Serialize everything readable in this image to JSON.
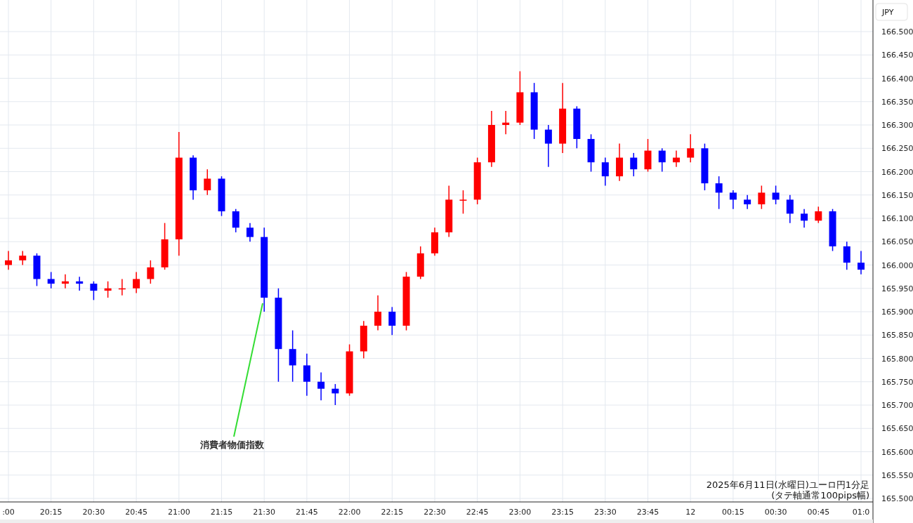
{
  "chart": {
    "currency_label": "JPY",
    "caption_lines": [
      "2025年6月11日(水曜日)ユーロ円1分足",
      "(タテ軸通常100pips幅)"
    ],
    "chart_data": {
      "type": "candlestick",
      "grid": true,
      "ylim": [
        165.5,
        166.5
      ],
      "categories": [
        ":00",
        null,
        null,
        "20:15",
        null,
        null,
        "20:30",
        null,
        null,
        "20:45",
        null,
        null,
        "21:00",
        null,
        null,
        "21:15",
        null,
        null,
        "21:30",
        null,
        null,
        "21:45",
        null,
        null,
        "22:00",
        null,
        null,
        "22:15",
        null,
        null,
        "22:30",
        null,
        null,
        "22:45",
        null,
        null,
        "23:00",
        null,
        null,
        "23:15",
        null,
        null,
        "23:30",
        null,
        null,
        "23:45",
        null,
        null,
        "12",
        null,
        null,
        "00:15",
        null,
        null,
        "00:30",
        null,
        null,
        "00:45",
        null,
        null,
        "01:0"
      ],
      "ohlc": [
        [
          166.0,
          166.03,
          165.99,
          166.01
        ],
        [
          166.01,
          166.03,
          166.0,
          166.02
        ],
        [
          166.02,
          166.025,
          165.955,
          165.97
        ],
        [
          165.97,
          165.985,
          165.95,
          165.96
        ],
        [
          165.96,
          165.98,
          165.95,
          165.965
        ],
        [
          165.965,
          165.975,
          165.945,
          165.96
        ],
        [
          165.96,
          165.965,
          165.925,
          165.945
        ],
        [
          165.945,
          165.965,
          165.93,
          165.95
        ],
        [
          165.95,
          165.97,
          165.935,
          165.95
        ],
        [
          165.95,
          165.985,
          165.94,
          165.97
        ],
        [
          165.97,
          166.01,
          165.96,
          165.995
        ],
        [
          165.995,
          166.09,
          165.99,
          166.055
        ],
        [
          166.055,
          166.285,
          166.02,
          166.23
        ],
        [
          166.23,
          166.235,
          166.14,
          166.16
        ],
        [
          166.16,
          166.205,
          166.15,
          166.185
        ],
        [
          166.185,
          166.19,
          166.105,
          166.115
        ],
        [
          166.115,
          166.12,
          166.07,
          166.08
        ],
        [
          166.08,
          166.09,
          166.05,
          166.06
        ],
        [
          166.06,
          166.08,
          165.9,
          165.93
        ],
        [
          165.93,
          165.95,
          165.75,
          165.82
        ],
        [
          165.82,
          165.86,
          165.75,
          165.785
        ],
        [
          165.785,
          165.81,
          165.72,
          165.75
        ],
        [
          165.75,
          165.77,
          165.71,
          165.735
        ],
        [
          165.735,
          165.745,
          165.7,
          165.725
        ],
        [
          165.725,
          165.83,
          165.72,
          165.815
        ],
        [
          165.815,
          165.88,
          165.8,
          165.87
        ],
        [
          165.87,
          165.935,
          165.86,
          165.9
        ],
        [
          165.9,
          165.91,
          165.85,
          165.87
        ],
        [
          165.87,
          165.985,
          165.86,
          165.975
        ],
        [
          165.975,
          166.04,
          165.97,
          166.025
        ],
        [
          166.025,
          166.08,
          166.02,
          166.07
        ],
        [
          166.07,
          166.17,
          166.06,
          166.14
        ],
        [
          166.14,
          166.16,
          166.11,
          166.14
        ],
        [
          166.14,
          166.23,
          166.13,
          166.22
        ],
        [
          166.22,
          166.33,
          166.21,
          166.3
        ],
        [
          166.3,
          166.33,
          166.28,
          166.305
        ],
        [
          166.305,
          166.415,
          166.3,
          166.37
        ],
        [
          166.37,
          166.39,
          166.27,
          166.29
        ],
        [
          166.29,
          166.3,
          166.21,
          166.26
        ],
        [
          166.26,
          166.39,
          166.24,
          166.335
        ],
        [
          166.335,
          166.34,
          166.25,
          166.27
        ],
        [
          166.27,
          166.28,
          166.2,
          166.22
        ],
        [
          166.22,
          166.23,
          166.17,
          166.19
        ],
        [
          166.19,
          166.26,
          166.18,
          166.23
        ],
        [
          166.23,
          166.24,
          166.19,
          166.205
        ],
        [
          166.205,
          166.27,
          166.2,
          166.245
        ],
        [
          166.245,
          166.25,
          166.2,
          166.22
        ],
        [
          166.22,
          166.245,
          166.21,
          166.23
        ],
        [
          166.23,
          166.28,
          166.22,
          166.25
        ],
        [
          166.25,
          166.26,
          166.16,
          166.175
        ],
        [
          166.175,
          166.19,
          166.12,
          166.155
        ],
        [
          166.155,
          166.16,
          166.12,
          166.14
        ],
        [
          166.14,
          166.15,
          166.12,
          166.13
        ],
        [
          166.13,
          166.17,
          166.12,
          166.155
        ],
        [
          166.155,
          166.17,
          166.13,
          166.14
        ],
        [
          166.14,
          166.15,
          166.09,
          166.11
        ],
        [
          166.11,
          166.12,
          166.08,
          166.095
        ],
        [
          166.095,
          166.125,
          166.09,
          166.115
        ],
        [
          166.115,
          166.12,
          166.03,
          166.04
        ],
        [
          166.04,
          166.05,
          165.99,
          166.005
        ],
        [
          166.005,
          166.03,
          165.98,
          165.99
        ]
      ],
      "yticks": [
        {
          "value": 166.5,
          "label": "166.500"
        },
        {
          "value": 166.45,
          "label": "166.450"
        },
        {
          "value": 166.4,
          "label": "166.400"
        },
        {
          "value": 166.35,
          "label": "166.350"
        },
        {
          "value": 166.3,
          "label": "166.300"
        },
        {
          "value": 166.25,
          "label": "166.250"
        },
        {
          "value": 166.2,
          "label": "166.200"
        },
        {
          "value": 166.15,
          "label": "166.150"
        },
        {
          "value": 166.1,
          "label": "166.100"
        },
        {
          "value": 166.05,
          "label": "166.050"
        },
        {
          "value": 166.0,
          "label": "166.000"
        },
        {
          "value": 165.95,
          "label": "165.950"
        },
        {
          "value": 165.9,
          "label": "165.900"
        },
        {
          "value": 165.85,
          "label": "165.850"
        },
        {
          "value": 165.8,
          "label": "165.800"
        },
        {
          "value": 165.75,
          "label": "165.750"
        },
        {
          "value": 165.7,
          "label": "165.700"
        },
        {
          "value": 165.65,
          "label": "165.650"
        },
        {
          "value": 165.6,
          "label": "165.600"
        },
        {
          "value": 165.55,
          "label": "165.550"
        },
        {
          "value": 165.5,
          "label": "165.500"
        }
      ],
      "annotations": [
        "消費者物価指数"
      ]
    }
  }
}
